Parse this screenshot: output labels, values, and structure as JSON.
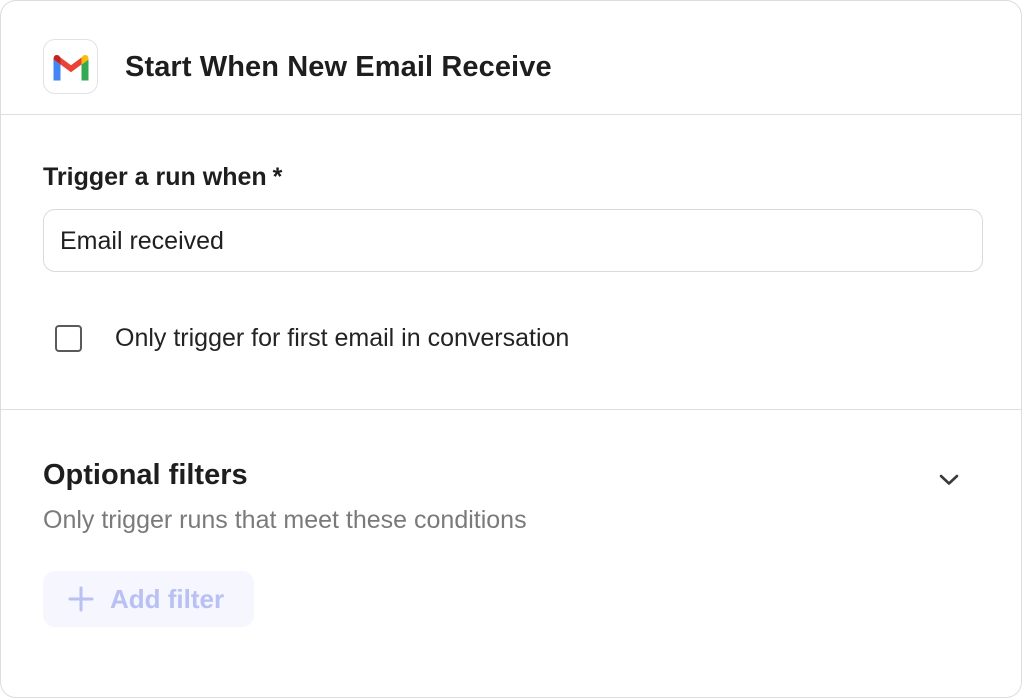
{
  "header": {
    "title": "Start When New Email Receive",
    "app_icon": "gmail-logo"
  },
  "trigger": {
    "label": "Trigger a run when",
    "required_marker": "*",
    "selected_value": "Email received"
  },
  "options": {
    "first_email_only": {
      "label": "Only trigger for first email in conversation",
      "checked": false
    }
  },
  "filters": {
    "title": "Optional filters",
    "subtitle": "Only trigger runs that meet these conditions",
    "expand_icon": "chevron-down-icon",
    "add_filter": {
      "label": "Add filter",
      "icon": "plus-icon",
      "enabled": false
    }
  },
  "colors": {
    "gmail_red": "#EA4335",
    "gmail_blue": "#4285F4",
    "gmail_green": "#34A853",
    "gmail_yellow": "#FBBC04",
    "gmail_dark_red": "#C5221F",
    "disabled_accent": "#B9C0F4",
    "disabled_bg": "#F5F6FE"
  }
}
